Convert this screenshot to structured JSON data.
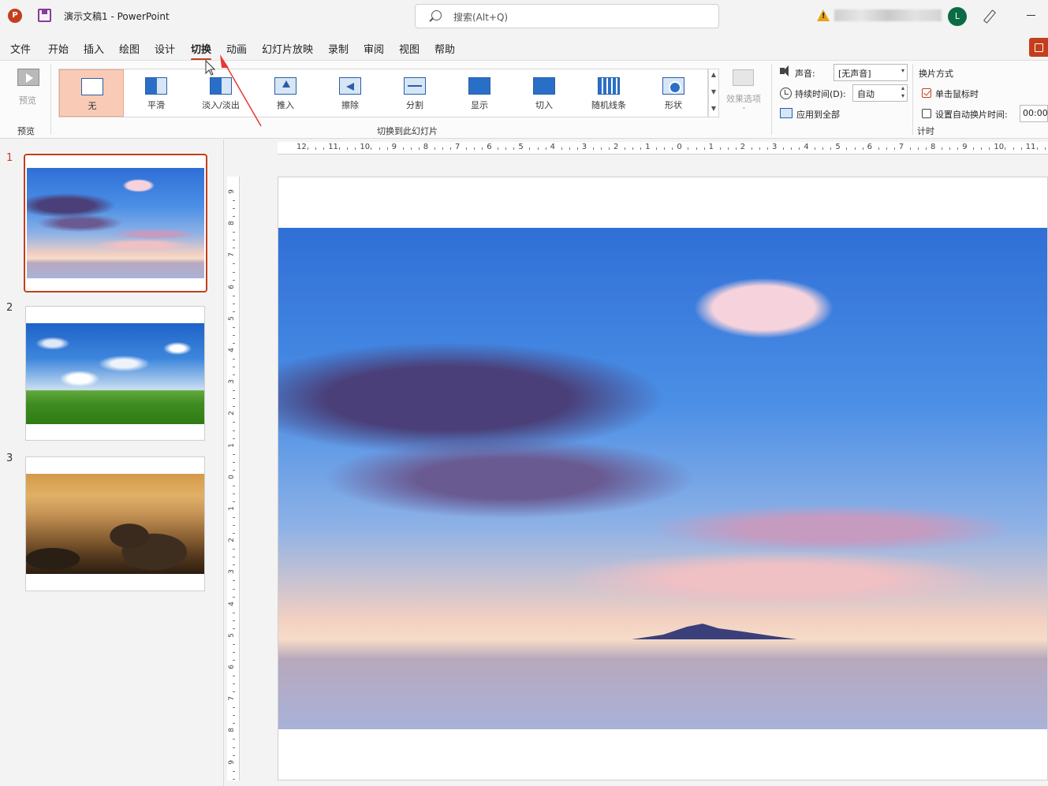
{
  "titlebar": {
    "doc_name": "演示文稿1  -  PowerPoint",
    "app_logo": "P",
    "search_placeholder": "搜索(Alt+Q)",
    "avatar_initial": "L"
  },
  "tabs": [
    {
      "label": "文件"
    },
    {
      "label": "开始"
    },
    {
      "label": "插入"
    },
    {
      "label": "绘图"
    },
    {
      "label": "设计"
    },
    {
      "label": "切换",
      "active": true
    },
    {
      "label": "动画"
    },
    {
      "label": "幻灯片放映"
    },
    {
      "label": "录制"
    },
    {
      "label": "审阅"
    },
    {
      "label": "视图"
    },
    {
      "label": "帮助"
    }
  ],
  "ribbon": {
    "preview_label": "预览",
    "preview_group": "预览",
    "transitions_group": "切换到此幻灯片",
    "transitions": [
      {
        "label": "无",
        "icon": "none-transition-icon"
      },
      {
        "label": "平滑",
        "icon": "morph-transition-icon"
      },
      {
        "label": "淡入/淡出",
        "icon": "fade-transition-icon"
      },
      {
        "label": "推入",
        "icon": "push-transition-icon"
      },
      {
        "label": "擦除",
        "icon": "wipe-transition-icon"
      },
      {
        "label": "分割",
        "icon": "split-transition-icon"
      },
      {
        "label": "显示",
        "icon": "reveal-transition-icon"
      },
      {
        "label": "切入",
        "icon": "cut-transition-icon"
      },
      {
        "label": "随机线条",
        "icon": "random-bars-transition-icon"
      },
      {
        "label": "形状",
        "icon": "shape-transition-icon"
      }
    ],
    "effect_options": "效果选项",
    "sound_label": "声音:",
    "sound_value": "[无声音]",
    "duration_label": "持续时间(D):",
    "duration_value": "自动",
    "apply_all": "应用到全部",
    "advance_title": "换片方式",
    "on_click_label": "单击鼠标时",
    "after_label": "设置自动换片时间:",
    "after_value": "00:00",
    "timing_group": "计时"
  },
  "slides": [
    {
      "number": "1",
      "image": "sky-sunset"
    },
    {
      "number": "2",
      "image": "green-field"
    },
    {
      "number": "3",
      "image": "mountain-clouds"
    }
  ],
  "ruler": {
    "h_labels": [
      "12",
      "11",
      "10",
      "9",
      "8",
      "7",
      "6",
      "5",
      "4",
      "3",
      "2",
      "1",
      "0",
      "1",
      "2",
      "3",
      "4",
      "5",
      "6",
      "7",
      "8",
      "9",
      "10",
      "11"
    ],
    "v_labels": [
      "9",
      "8",
      "7",
      "6",
      "5",
      "4",
      "3",
      "2",
      "1",
      "0",
      "1",
      "2",
      "3",
      "4",
      "5",
      "6",
      "7",
      "8",
      "9"
    ]
  },
  "colors": {
    "accent": "#c43e1c",
    "selected_transition": "#f9cbb7",
    "avatar_bg": "#0b6b45"
  }
}
